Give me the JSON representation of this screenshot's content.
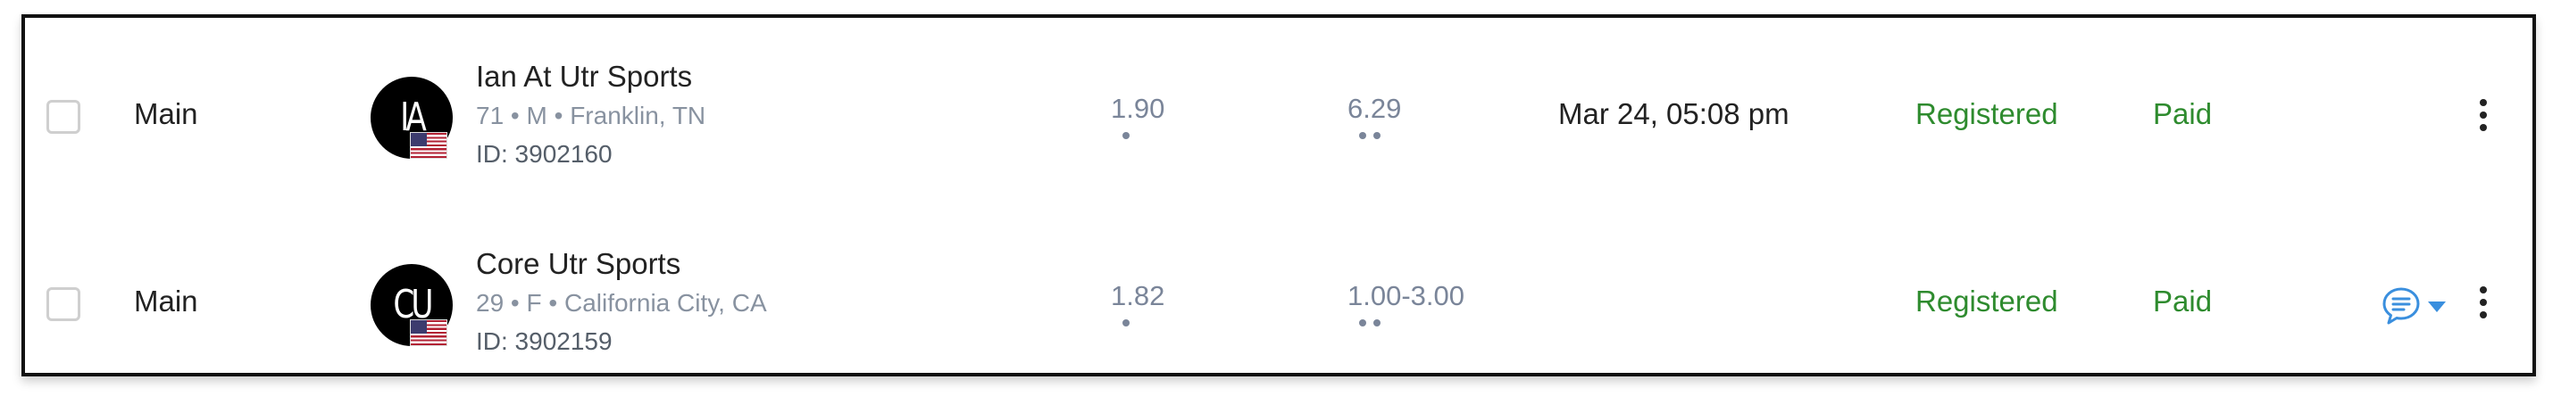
{
  "rows": [
    {
      "draw": "Main",
      "avatar_initials": "IA",
      "name": "Ian At Utr Sports",
      "meta": "71 • M • Franklin, TN",
      "id_label": "ID: 3902160",
      "rating1": "1.90",
      "rating2": "6.29",
      "date": "Mar 24, 05:08 pm",
      "status": "Registered",
      "payment": "Paid"
    },
    {
      "draw": "Main",
      "avatar_initials": "CU",
      "name": "Core Utr Sports",
      "meta": "29 • F • California City, CA",
      "id_label": "ID: 3902159",
      "rating1": "1.82",
      "rating2": "1.00-3.00",
      "date": "",
      "status": "Registered",
      "payment": "Paid"
    }
  ],
  "icons": {
    "flag": "us-flag-icon",
    "message": "message-icon",
    "caret": "caret-down-icon",
    "more": "more-vertical-icon"
  },
  "colors": {
    "status_green": "#2e8b2e",
    "rating_gray": "#7a8599",
    "message_blue": "#3a8fde"
  }
}
